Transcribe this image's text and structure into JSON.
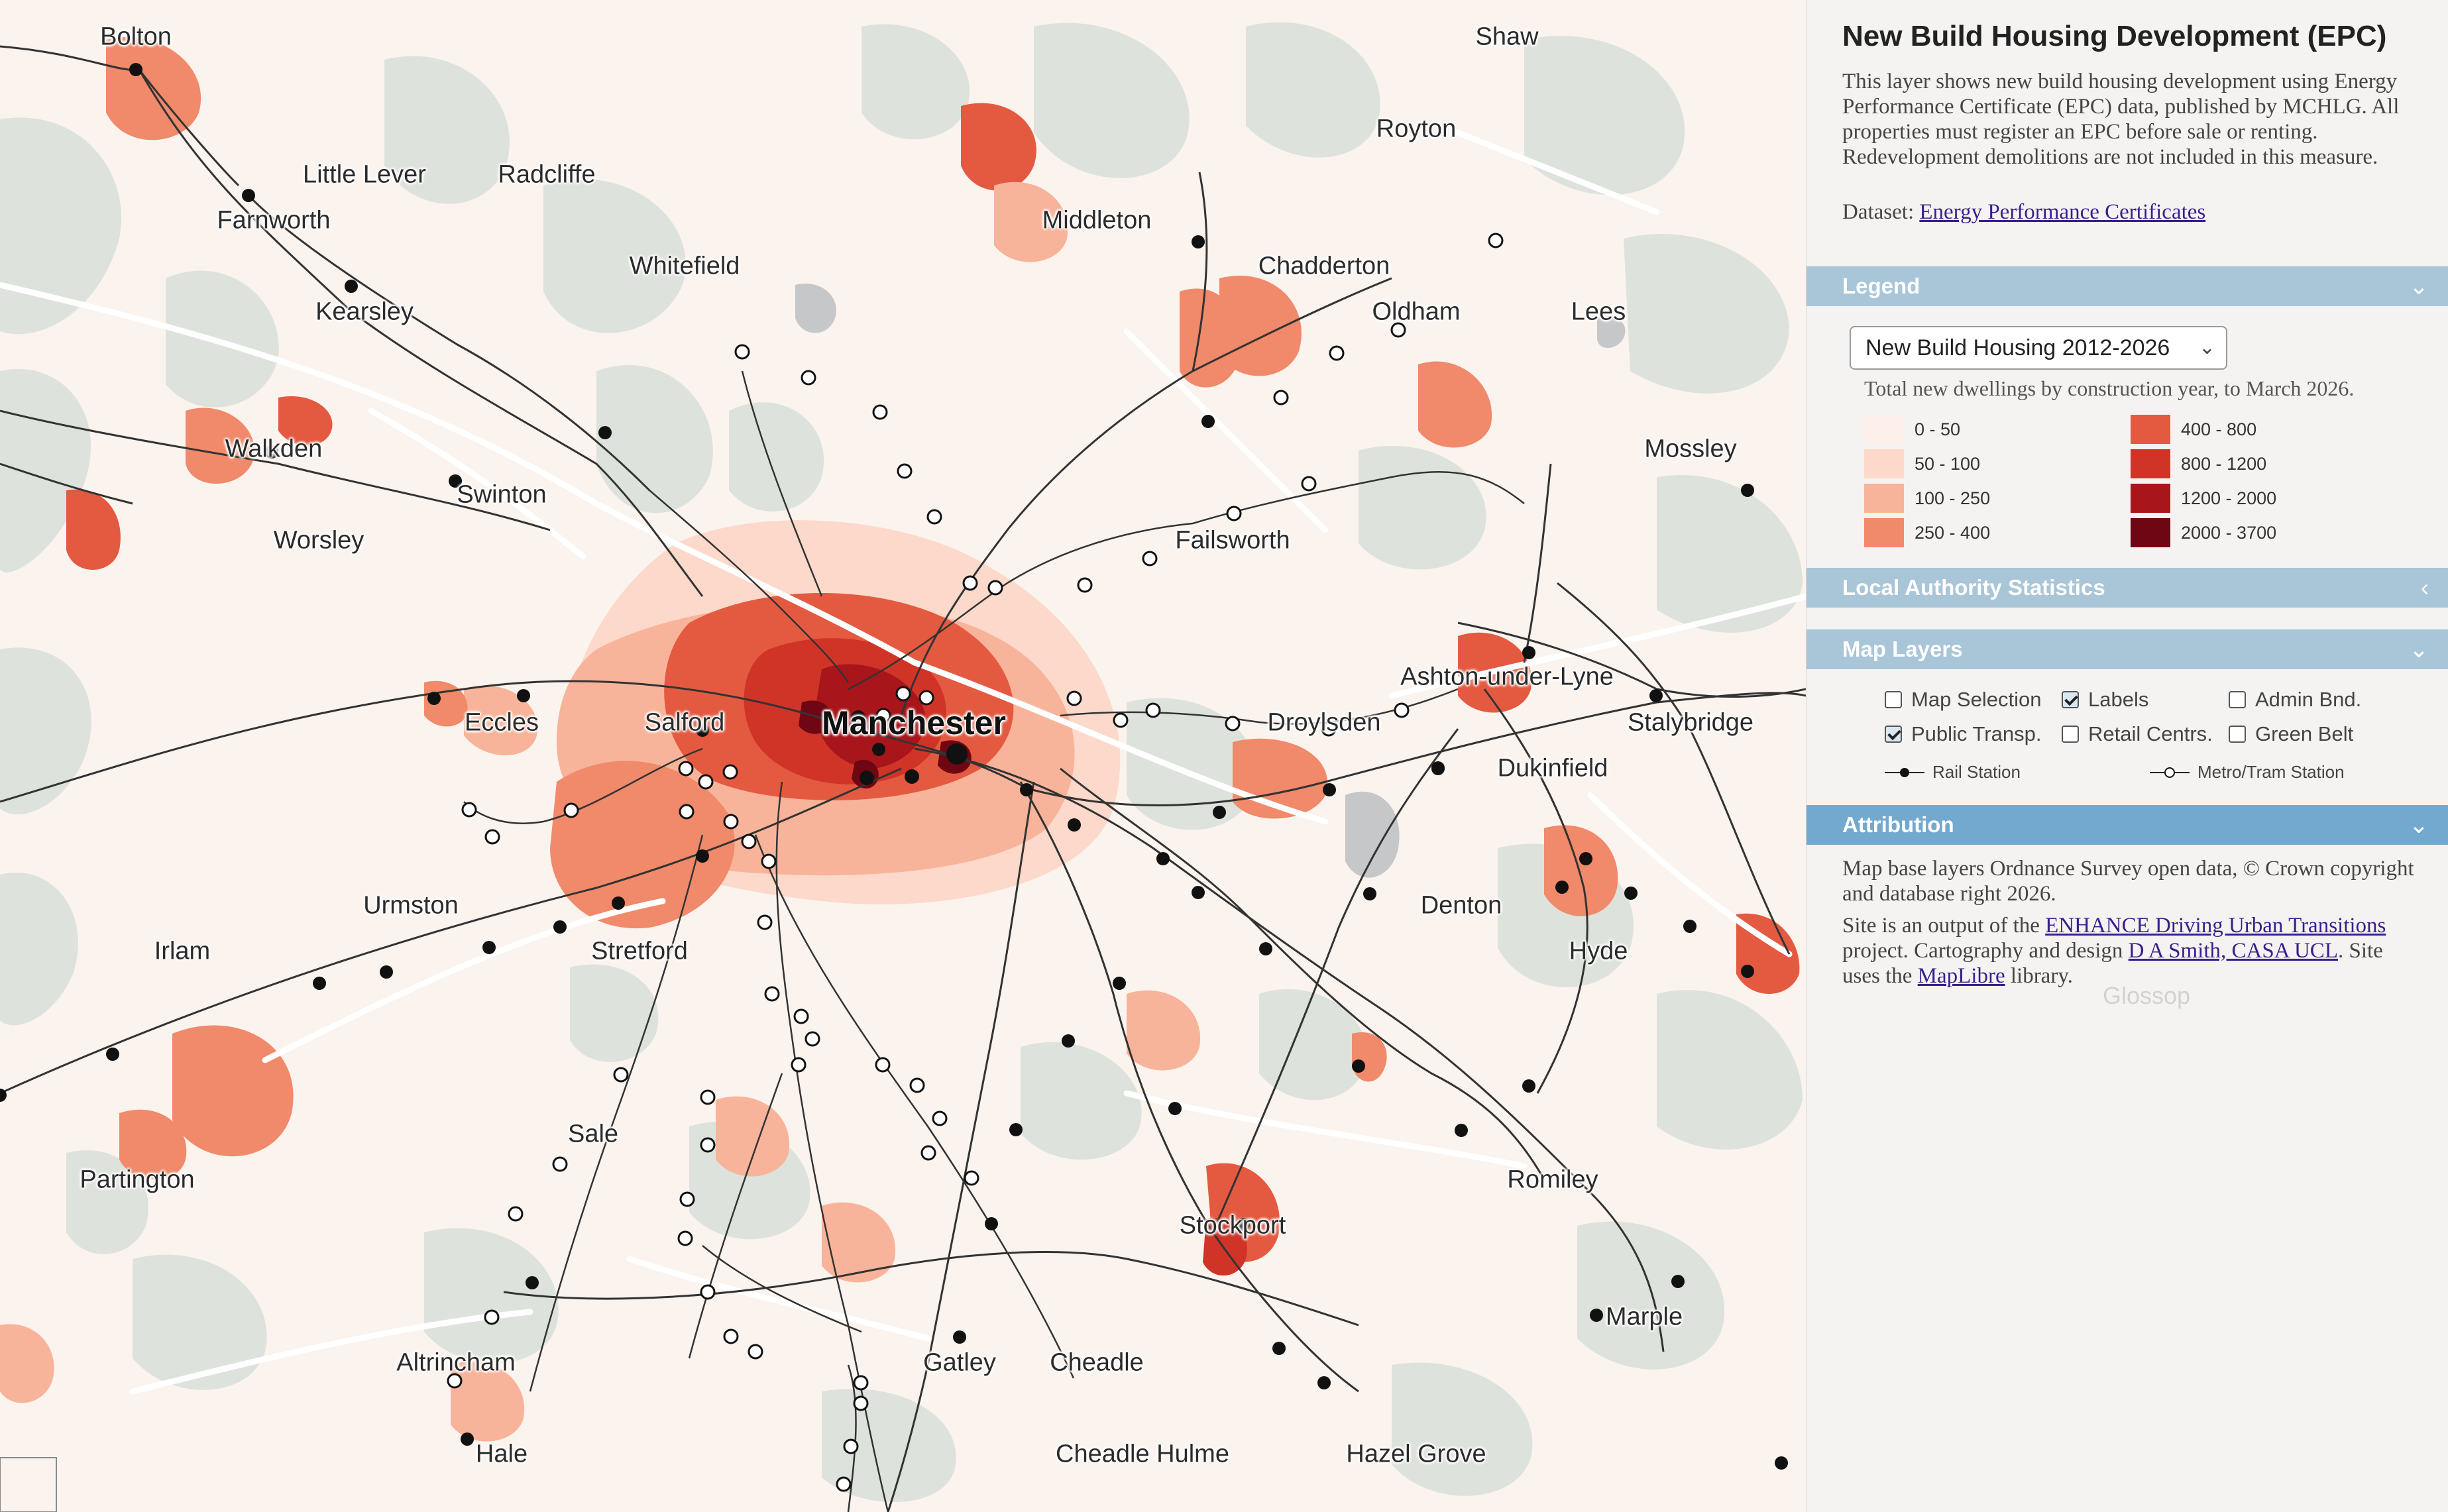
{
  "map": {
    "places": [
      {
        "name": "Bolton",
        "cls": ""
      },
      {
        "name": "Shaw",
        "cls": ""
      },
      {
        "name": "Royton",
        "cls": ""
      },
      {
        "name": "Little Lever",
        "cls": ""
      },
      {
        "name": "Radcliffe",
        "cls": ""
      },
      {
        "name": "Farnworth",
        "cls": ""
      },
      {
        "name": "Middleton",
        "cls": ""
      },
      {
        "name": "Whitefield",
        "cls": ""
      },
      {
        "name": "Chadderton",
        "cls": ""
      },
      {
        "name": "Kearsley",
        "cls": ""
      },
      {
        "name": "Oldham",
        "cls": ""
      },
      {
        "name": "Lees",
        "cls": ""
      },
      {
        "name": "Walkden",
        "cls": ""
      },
      {
        "name": "Mossley",
        "cls": ""
      },
      {
        "name": "Swinton",
        "cls": ""
      },
      {
        "name": "Worsley",
        "cls": ""
      },
      {
        "name": "Failsworth",
        "cls": ""
      },
      {
        "name": "Ashton-under-Lyne",
        "cls": ""
      },
      {
        "name": "Eccles",
        "cls": ""
      },
      {
        "name": "Salford",
        "cls": ""
      },
      {
        "name": "Manchester",
        "cls": "big"
      },
      {
        "name": "Droylsden",
        "cls": ""
      },
      {
        "name": "Stalybridge",
        "cls": ""
      },
      {
        "name": "Dukinfield",
        "cls": ""
      },
      {
        "name": "Urmston",
        "cls": ""
      },
      {
        "name": "Denton",
        "cls": ""
      },
      {
        "name": "Irlam",
        "cls": ""
      },
      {
        "name": "Stretford",
        "cls": ""
      },
      {
        "name": "Hyde",
        "cls": ""
      },
      {
        "name": "Sale",
        "cls": ""
      },
      {
        "name": "Partington",
        "cls": ""
      },
      {
        "name": "Romiley",
        "cls": ""
      },
      {
        "name": "Stockport",
        "cls": ""
      },
      {
        "name": "Marple",
        "cls": ""
      },
      {
        "name": "Altrincham",
        "cls": ""
      },
      {
        "name": "Gatley",
        "cls": ""
      },
      {
        "name": "Cheadle",
        "cls": ""
      },
      {
        "name": "Hale",
        "cls": ""
      },
      {
        "name": "Cheadle Hulme",
        "cls": ""
      },
      {
        "name": "Hazel Grove",
        "cls": ""
      },
      {
        "name": "Glossop",
        "cls": ""
      }
    ]
  },
  "panel": {
    "title": "New Build Housing Development (EPC)",
    "description": "This layer shows new build housing development using Energy Performance Certificate (EPC) data, published by MCHLG. All properties must register an EPC before sale or renting. Redevelopment demolitions are not included in this measure.",
    "dataset_label": "Dataset:",
    "dataset_link": "Energy Performance Certificates"
  },
  "legend": {
    "header": "Legend",
    "select_value": "New Build Housing 2012-2026",
    "subtitle": "Total new dwellings by construction year, to March 2026.",
    "classes": [
      {
        "label": "0 - 50",
        "color": "#fdf0ea"
      },
      {
        "label": "50 - 100",
        "color": "#fcd9ca"
      },
      {
        "label": "100 - 250",
        "color": "#f8b49a"
      },
      {
        "label": "250 - 400",
        "color": "#f08a6b"
      },
      {
        "label": "400 - 800",
        "color": "#e45a41"
      },
      {
        "label": "800 - 1200",
        "color": "#d03427"
      },
      {
        "label": "1200 - 2000",
        "color": "#a8161b"
      },
      {
        "label": "2000 - 3700",
        "color": "#6e0613"
      }
    ]
  },
  "las_header": "Local Authority Statistics",
  "layers": {
    "header": "Map Layers",
    "items": [
      {
        "label": "Map Selection",
        "checked": false
      },
      {
        "label": "Labels",
        "checked": true
      },
      {
        "label": "Admin Bnd.",
        "checked": false
      },
      {
        "label": "Public Transp.",
        "checked": true
      },
      {
        "label": "Retail Centrs.",
        "checked": false
      },
      {
        "label": "Green Belt",
        "checked": false
      }
    ],
    "rail_label": "Rail Station",
    "metro_label": "Metro/Tram Station"
  },
  "attribution": {
    "header": "Attribution",
    "line1": "Map base layers Ordnance Survey open data, © Crown copyright and database right 2026.",
    "p2_a": "Site is an output of the ",
    "p2_link1": "ENHANCE Driving Urban Transitions",
    "p2_b": " project. Cartography and design ",
    "p2_link2": "D A Smith, CASA UCL",
    "p2_c": ". Site uses the ",
    "p2_link3": "MapLibre",
    "p2_d": " library."
  },
  "colors": {
    "green": "#dde3dc",
    "rail": "#333333",
    "panel_bar": "#a9c5d8",
    "panel_bar_active": "#74a9cf"
  }
}
